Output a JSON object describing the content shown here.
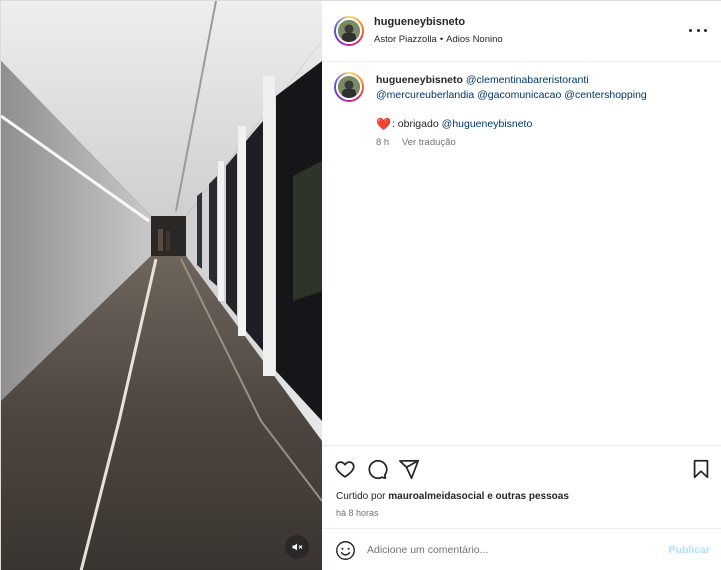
{
  "post": {
    "username": "hugueneybisneto",
    "audio": {
      "artist": "Astor Piazzolla",
      "separator": "•",
      "track": "Adios Nonino"
    }
  },
  "caption": {
    "username": "hugueneybisneto",
    "mentions": [
      "@clementinabareristoranti",
      "@mercureuberlandia",
      "@gacomunicacao",
      "@centershopping"
    ],
    "reply_heart": "❤️",
    "reply_text": ": obrigado",
    "reply_mention": "@hugueneybisneto",
    "age": "8 h",
    "translate": "Ver tradução"
  },
  "likes": {
    "prefix": "Curtido por",
    "user": "mauroalmeidasocial",
    "suffix": "e outras pessoas"
  },
  "posted_time": "há 8 horas",
  "comment": {
    "placeholder": "Adicione um comentário...",
    "publish_label": "Publicar"
  },
  "icons": {
    "more": "more-horizontal-icon",
    "like": "heart-icon",
    "comment": "comment-icon",
    "share": "send-icon",
    "save": "bookmark-icon",
    "emoji": "emoji-icon",
    "mute": "muted-speaker-icon"
  },
  "colors": {
    "mention": "#00376b",
    "secondary_text": "#737373",
    "publish_disabled": "#b2dffc",
    "heart": "#ed4956"
  }
}
